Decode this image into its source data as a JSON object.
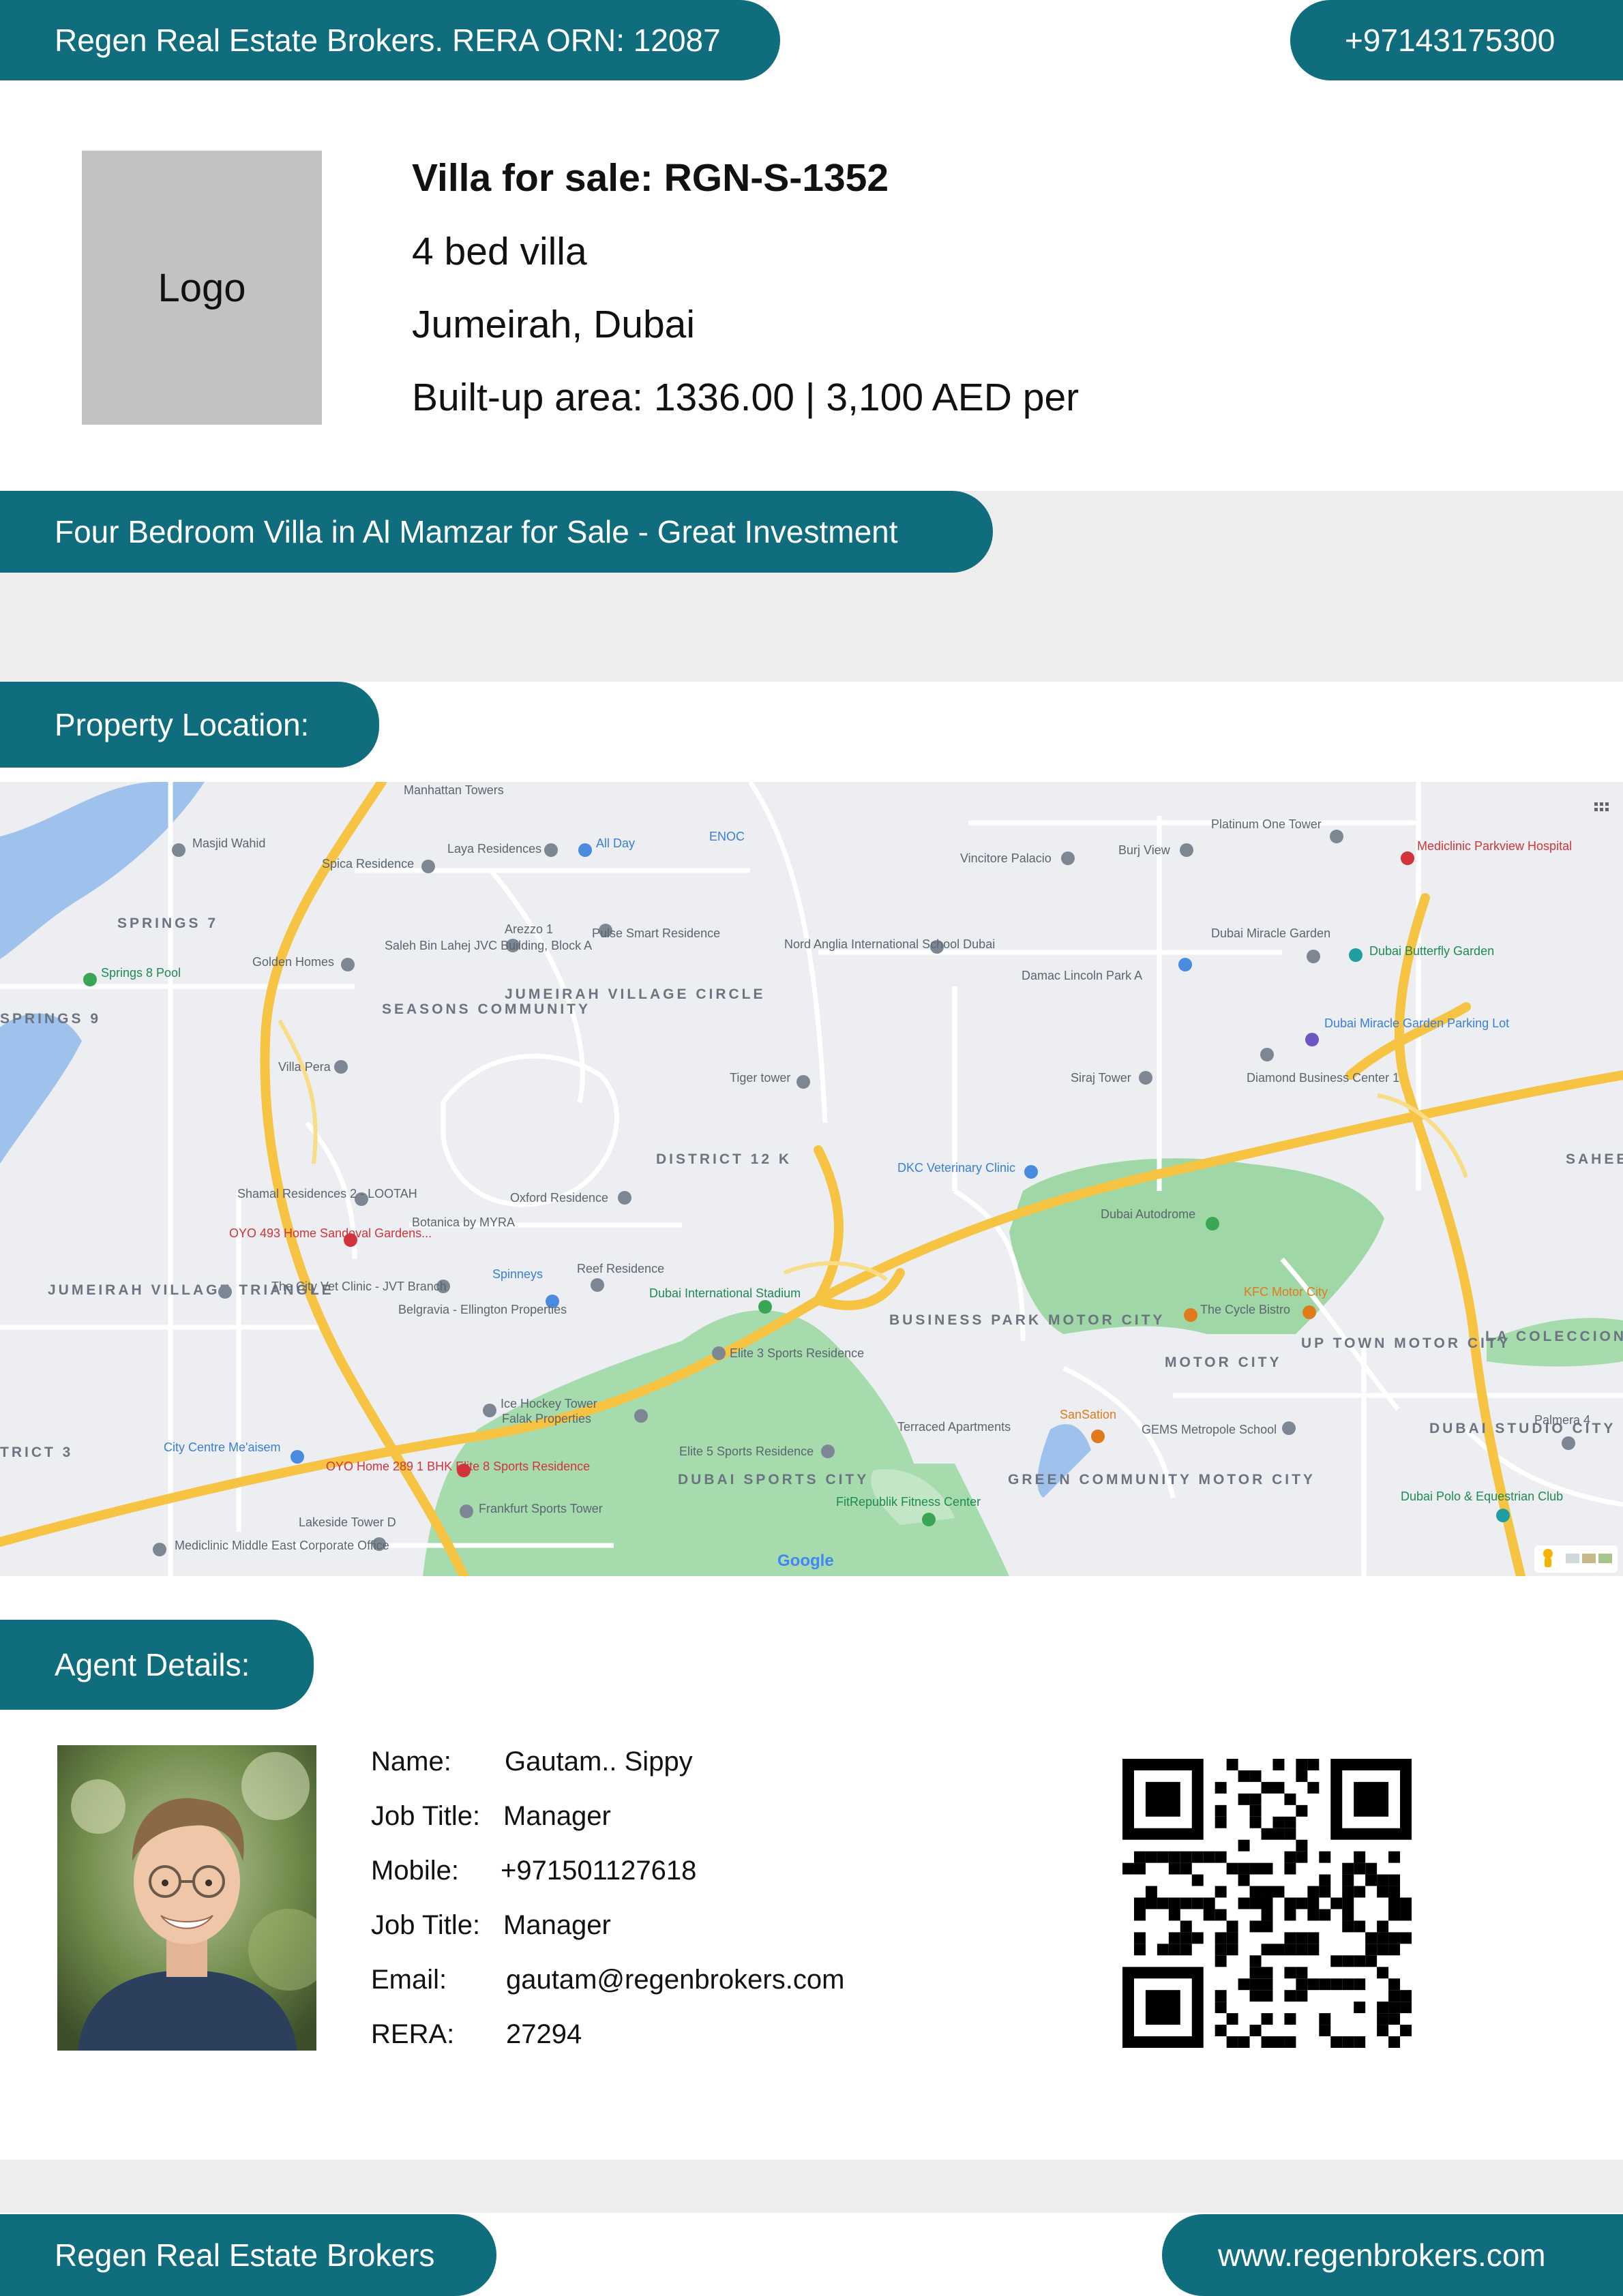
{
  "header": {
    "broker_rera": "Regen Real Estate Brokers. RERA ORN: 12087",
    "phone": "+97143175300"
  },
  "logo": {
    "label": "Logo"
  },
  "property": {
    "title": "Villa for sale: RGN-S-1352",
    "beds": "4 bed villa",
    "location": "Jumeirah, Dubai",
    "area": "Built-up area: 1336.00 | 3,100 AED per",
    "headline": "Four Bedroom Villa in Al Mamzar for Sale - Great Investment"
  },
  "location_section": {
    "heading": "Property Location:",
    "map": {
      "districts": [
        "SPRINGS 7",
        "SPRINGS 9",
        "SEASONS COMMUNITY",
        "JUMEIRAH VILLAGE CIRCLE",
        "DISTRICT 12 K",
        "JUMEIRAH VILLAGE TRIANGLE",
        "BUSINESS PARK MOTOR CITY",
        "MOTOR CITY",
        "UP TOWN MOTOR CITY",
        "DUBAI STUDIO CITY",
        "DUBAI SPORTS CITY",
        "GREEN COMMUNITY MOTOR CITY",
        "SAHEEL",
        "LA COLECCION",
        "TRICT 3"
      ],
      "places": [
        "Manhattan Towers",
        "Masjid Wahid",
        "Spica Residence",
        "Laya Residences",
        "All Day",
        "ENOC",
        "Vincitore Palacio",
        "Burj View",
        "Platinum One Tower",
        "Mediclinic Parkview Hospital",
        "Springs 8 Pool",
        "Golden Homes",
        "Saleh Bin Lahej JVC Building, Block A",
        "Arezzo 1",
        "Pulse Smart Residence",
        "Nord Anglia International School Dubai",
        "Damac Lincoln Park A",
        "Dubai Miracle Garden",
        "Dubai Butterfly Garden",
        "Dubai Miracle Garden Parking Lot",
        "Villa Pera",
        "Tiger tower",
        "Siraj Tower",
        "Diamond Business Center 1",
        "DKC Veterinary Clinic",
        "Dubai Autodrome",
        "Shamal Residences 2 - LOOTAH",
        "Oxford Residence",
        "Botanica by MYRA",
        "OYO 493 Home Sandoval Gardens...",
        "Spinneys",
        "Reef Residence",
        "The City Vet Clinic - JVT Branch",
        "Belgravia - Ellington Properties",
        "Dubai International Stadium",
        "KFC Motor City",
        "The Cycle Bistro",
        "Elite 3 Sports Residence",
        "Ice Hockey Tower",
        "Falak Properties",
        "Elite 5 Sports Residence",
        "Terraced Apartments",
        "SanSation",
        "GEMS Metropole School",
        "Palmera 4",
        "City Centre Me'aisem",
        "OYO Home 289 1 BHK Elite 8 Sports Residence",
        "Frankfurt Sports Tower",
        "FitRepublik Fitness Center",
        "Dubai Polo & Equestrian Club",
        "Lakeside Tower D",
        "Mediclinic Middle East Corporate Office",
        "Google"
      ]
    }
  },
  "agent_section": {
    "heading": "Agent Details:",
    "rows": [
      {
        "label": "Name:",
        "value": "Gautam.. Sippy"
      },
      {
        "label": "Job Title:",
        "value": "Manager"
      },
      {
        "label": "Mobile:",
        "value": "+971501127618"
      },
      {
        "label": "Job Title:",
        "value": "Manager"
      },
      {
        "label": "Email:",
        "value": "gautam@regenbrokers.com"
      },
      {
        "label": "RERA:",
        "value": "27294"
      }
    ]
  },
  "footer": {
    "company": "Regen Real Estate Brokers",
    "website": "www.regenbrokers.com"
  },
  "colors": {
    "brand": "#0f6d7e",
    "band": "#ededed",
    "logo_box": "#c2c2c2"
  }
}
